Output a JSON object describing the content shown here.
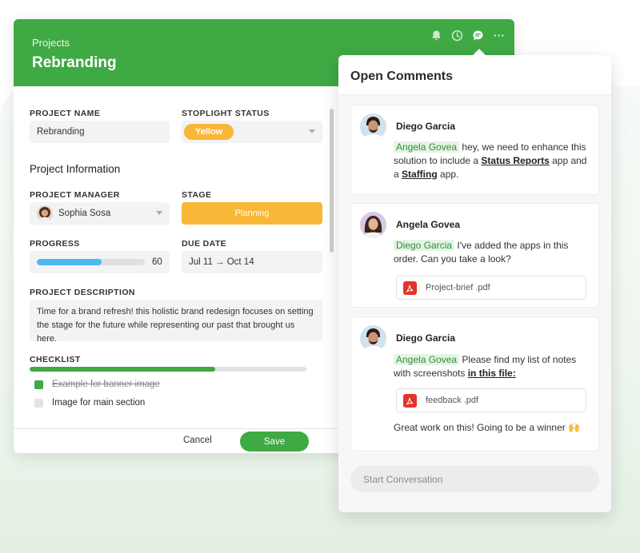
{
  "project": {
    "breadcrumb": "Projects",
    "title": "Rebranding",
    "labels": {
      "name": "PROJECT NAME",
      "stoplight": "STOPLIGHT STATUS",
      "manager": "PROJECT MANAGER",
      "stage": "STAGE",
      "progress": "PROGRESS",
      "due": "DUE DATE",
      "description": "PROJECT DESCRIPTION",
      "checklist": "CHECKLIST"
    },
    "section_title": "Project Information",
    "name_value": "Rebranding",
    "stoplight_value": "Yellow",
    "manager_value": "Sophia Sosa",
    "stage_value": "Planning",
    "progress_value": "60",
    "progress_fraction": 0.6,
    "due_value": "Jul 11 → Oct 14",
    "description_value": "Time for a brand refresh! this holistic brand redesign focuses on setting the stage for the future while representing our past that brought us here.",
    "checklist_fraction": 0.67,
    "checklist": [
      {
        "label": "Example for banner image",
        "done": true
      },
      {
        "label": "Image for main section",
        "done": false
      }
    ],
    "cancel_label": "Cancel",
    "save_label": "Save"
  },
  "header_icons": [
    "bell-icon",
    "clock-icon",
    "comment-icon",
    "more-icon"
  ],
  "comments_panel": {
    "title": "Open Comments",
    "comments": [
      {
        "author": "Diego Garcia",
        "mention": "Angela Govea",
        "text_a": " hey, we need to enhance this solution to include a ",
        "link_a": "Status Reports",
        "text_b": " app and a ",
        "link_b": "Staffing",
        "text_c": " app."
      },
      {
        "author": "Angela Govea",
        "mention": "Diego Garcia",
        "text_a": " I've added the apps in this order. Can you take a look?",
        "file": "Project-brief .pdf"
      },
      {
        "author": "Diego Garcia",
        "mention": "Angela Govea",
        "text_a": " Please find my list of notes with screenshots ",
        "link_a": "in this file:",
        "file": "feedback .pdf",
        "text_after": "Great work on this! Going to be a winner 🙌"
      }
    ],
    "input_placeholder": "Start Conversation"
  },
  "colors": {
    "brand_green": "#3fa944",
    "stage_yellow": "#f8b737",
    "progress_blue": "#4db8f0",
    "pdf_red": "#e5332a"
  }
}
